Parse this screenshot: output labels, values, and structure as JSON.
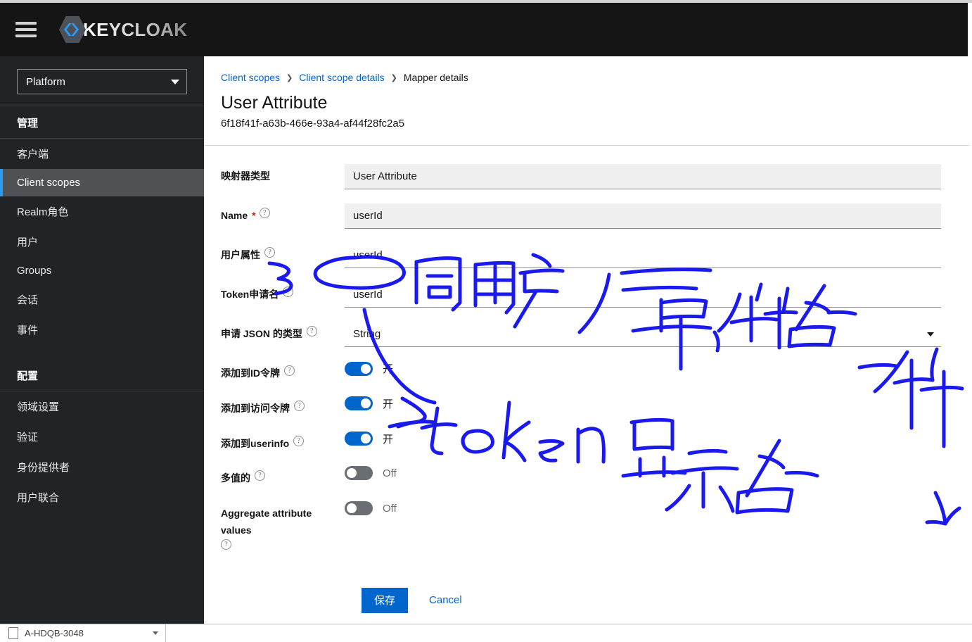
{
  "masthead": {
    "menu_icon": "hamburger-icon",
    "brand_name": "KEYCLOAK",
    "brand_logo_icon": "keycloak-logo-icon"
  },
  "sidebar": {
    "realm_selector": {
      "value": "Platform",
      "caret_icon": "chevron-down-icon"
    },
    "groups": [
      {
        "header": "管理",
        "items": [
          {
            "label": "客户端",
            "selected": false
          },
          {
            "label": "Client scopes",
            "selected": true
          },
          {
            "label": "Realm角色",
            "selected": false
          },
          {
            "label": "用户",
            "selected": false
          },
          {
            "label": "Groups",
            "selected": false
          },
          {
            "label": "会话",
            "selected": false
          },
          {
            "label": "事件",
            "selected": false
          }
        ]
      },
      {
        "header": "配置",
        "items": [
          {
            "label": "领域设置",
            "selected": false
          },
          {
            "label": "验证",
            "selected": false
          },
          {
            "label": "身份提供者",
            "selected": false
          },
          {
            "label": "用户联合",
            "selected": false
          }
        ]
      }
    ],
    "accent_color": "#2b9af3",
    "background_color": "#212427",
    "selected_background": "#4f5255"
  },
  "breadcrumb": [
    {
      "label": "Client scopes",
      "link": true
    },
    {
      "label": "Client scope details",
      "link": true
    },
    {
      "label": "Mapper details",
      "link": false
    }
  ],
  "page": {
    "title": "User Attribute",
    "subtitle": "6f18f41f-a63b-466e-93a4-af44f28fc2a5"
  },
  "form": {
    "fields": [
      {
        "label": "映射器类型",
        "required": false,
        "help": false,
        "value": "User Attribute",
        "kind": "text",
        "disabled": true
      },
      {
        "label": "Name",
        "required": true,
        "help": true,
        "value": "userId",
        "kind": "text",
        "disabled": true
      },
      {
        "label": "用户属性",
        "required": false,
        "help": true,
        "value": "userId",
        "kind": "text",
        "disabled": false
      },
      {
        "label": "Token申请名",
        "required": false,
        "help": true,
        "value": "userId",
        "kind": "text",
        "disabled": false
      },
      {
        "label": "申请 JSON 的类型",
        "required": false,
        "help": true,
        "value": "String",
        "kind": "select",
        "disabled": false
      }
    ],
    "toggles": [
      {
        "label": "添加到ID令牌",
        "help": true,
        "on": true,
        "state_label": "开"
      },
      {
        "label": "添加到访问令牌",
        "help": true,
        "on": true,
        "state_label": "开"
      },
      {
        "label": "添加到userinfo",
        "help": true,
        "on": true,
        "state_label": "开"
      },
      {
        "label": "多值的",
        "help": true,
        "on": false,
        "state_label": "Off"
      },
      {
        "label": "Aggregate attribute values",
        "help": true,
        "on": false,
        "state_label": "Off"
      }
    ],
    "save_label": "保存",
    "cancel_label": "Cancel",
    "primary_color": "#0066cc"
  },
  "annotations": {
    "ink_color": "#1a1aee",
    "notes": [
      "同用户属性名一样",
      "→ token 显示名"
    ]
  },
  "taskbar": {
    "download_item": "A-HDQB-3048",
    "file_icon": "file-icon",
    "caret_icon": "chevron-down-icon"
  }
}
